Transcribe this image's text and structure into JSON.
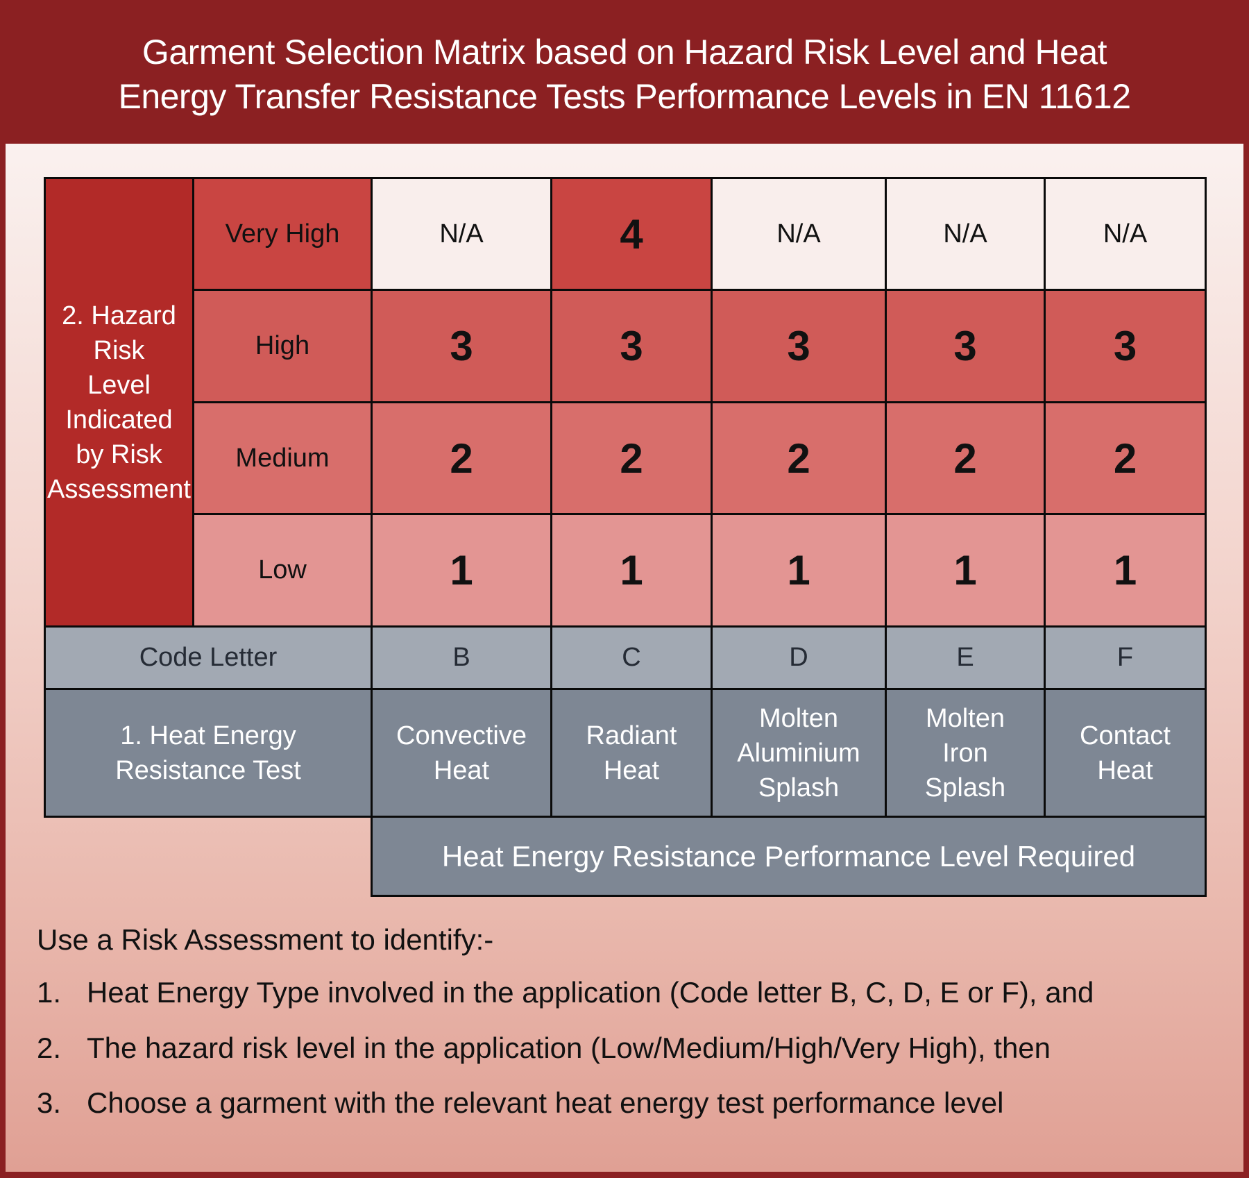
{
  "header": {
    "title_line1": "Garment Selection Matrix based on Hazard Risk Level and Heat",
    "title_line2": "Energy Transfer Resistance Tests Performance Levels in EN 11612"
  },
  "matrix": {
    "hazard_axis_label": "2. Hazard Risk Level Indicated by Risk Assessment",
    "hazard_axis_lines": [
      "2. Hazard",
      "Risk",
      "Level",
      "Indicated",
      "by Risk",
      "Assessment"
    ],
    "risk_levels": [
      "Very High",
      "High",
      "Medium",
      "Low"
    ],
    "code_letter_label": "Code Letter",
    "test_label_lines": [
      "1. Heat Energy",
      "Resistance Test"
    ],
    "columns": [
      {
        "code": "B",
        "test_lines": [
          "Convective",
          "Heat"
        ]
      },
      {
        "code": "C",
        "test_lines": [
          "Radiant",
          "Heat"
        ]
      },
      {
        "code": "D",
        "test_lines": [
          "Molten",
          "Aluminium",
          "Splash"
        ]
      },
      {
        "code": "E",
        "test_lines": [
          "Molten",
          "Iron",
          "Splash"
        ]
      },
      {
        "code": "F",
        "test_lines": [
          "Contact",
          "Heat"
        ]
      }
    ],
    "values": [
      [
        "N/A",
        "4",
        "N/A",
        "N/A",
        "N/A"
      ],
      [
        "3",
        "3",
        "3",
        "3",
        "3"
      ],
      [
        "2",
        "2",
        "2",
        "2",
        "2"
      ],
      [
        "1",
        "1",
        "1",
        "1",
        "1"
      ]
    ],
    "footer_label": "Heat Energy Resistance Performance Level Required"
  },
  "instructions": {
    "heading": "Use a Risk Assessment to identify:-",
    "items": [
      {
        "num": "1.",
        "text": "Heat Energy Type involved in the application (Code letter B, C, D, E or F), and"
      },
      {
        "num": "2.",
        "text": "The hazard risk level in the application (Low/Medium/High/Very High), then"
      },
      {
        "num": "3.",
        "text": "Choose a garment with the relevant heat energy test performance level"
      }
    ]
  },
  "colors": {
    "header_bg": "#8B2022",
    "hazard_label_bg": "#B22A28",
    "very_high": "#C94542",
    "high": "#D05B58",
    "medium": "#D86E6B",
    "low": "#E39593",
    "not_applicable": "#F9EEEC",
    "code_row": "#A2A9B3",
    "test_row": "#7E8794"
  }
}
